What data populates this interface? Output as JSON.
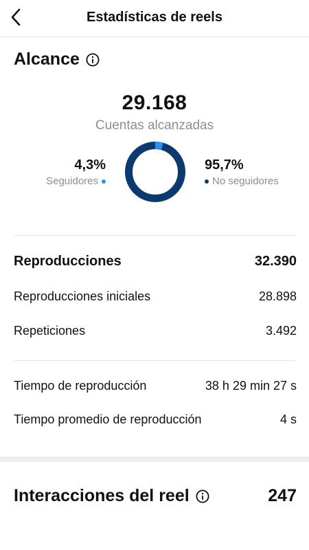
{
  "header": {
    "title": "Estadísticas de reels"
  },
  "reach": {
    "title": "Alcance",
    "total": "29.168",
    "total_label": "Cuentas alcanzadas",
    "followers": {
      "percent": "4,3%",
      "label": "Seguidores",
      "fraction": 0.043,
      "color": "#2f8ff0"
    },
    "non_followers": {
      "percent": "95,7%",
      "label": "No seguidores",
      "fraction": 0.957,
      "color": "#0a3a6e"
    }
  },
  "plays": {
    "total_label": "Reproducciones",
    "total_value": "32.390",
    "initial_label": "Reproducciones iniciales",
    "initial_value": "28.898",
    "replays_label": "Repeticiones",
    "replays_value": "3.492"
  },
  "watch_time": {
    "total_label": "Tiempo de reproducción",
    "total_value": "38 h 29 min 27 s",
    "avg_label": "Tiempo promedio de reproducción",
    "avg_value": "4 s"
  },
  "interactions": {
    "title": "Interacciones del reel",
    "value": "247"
  }
}
